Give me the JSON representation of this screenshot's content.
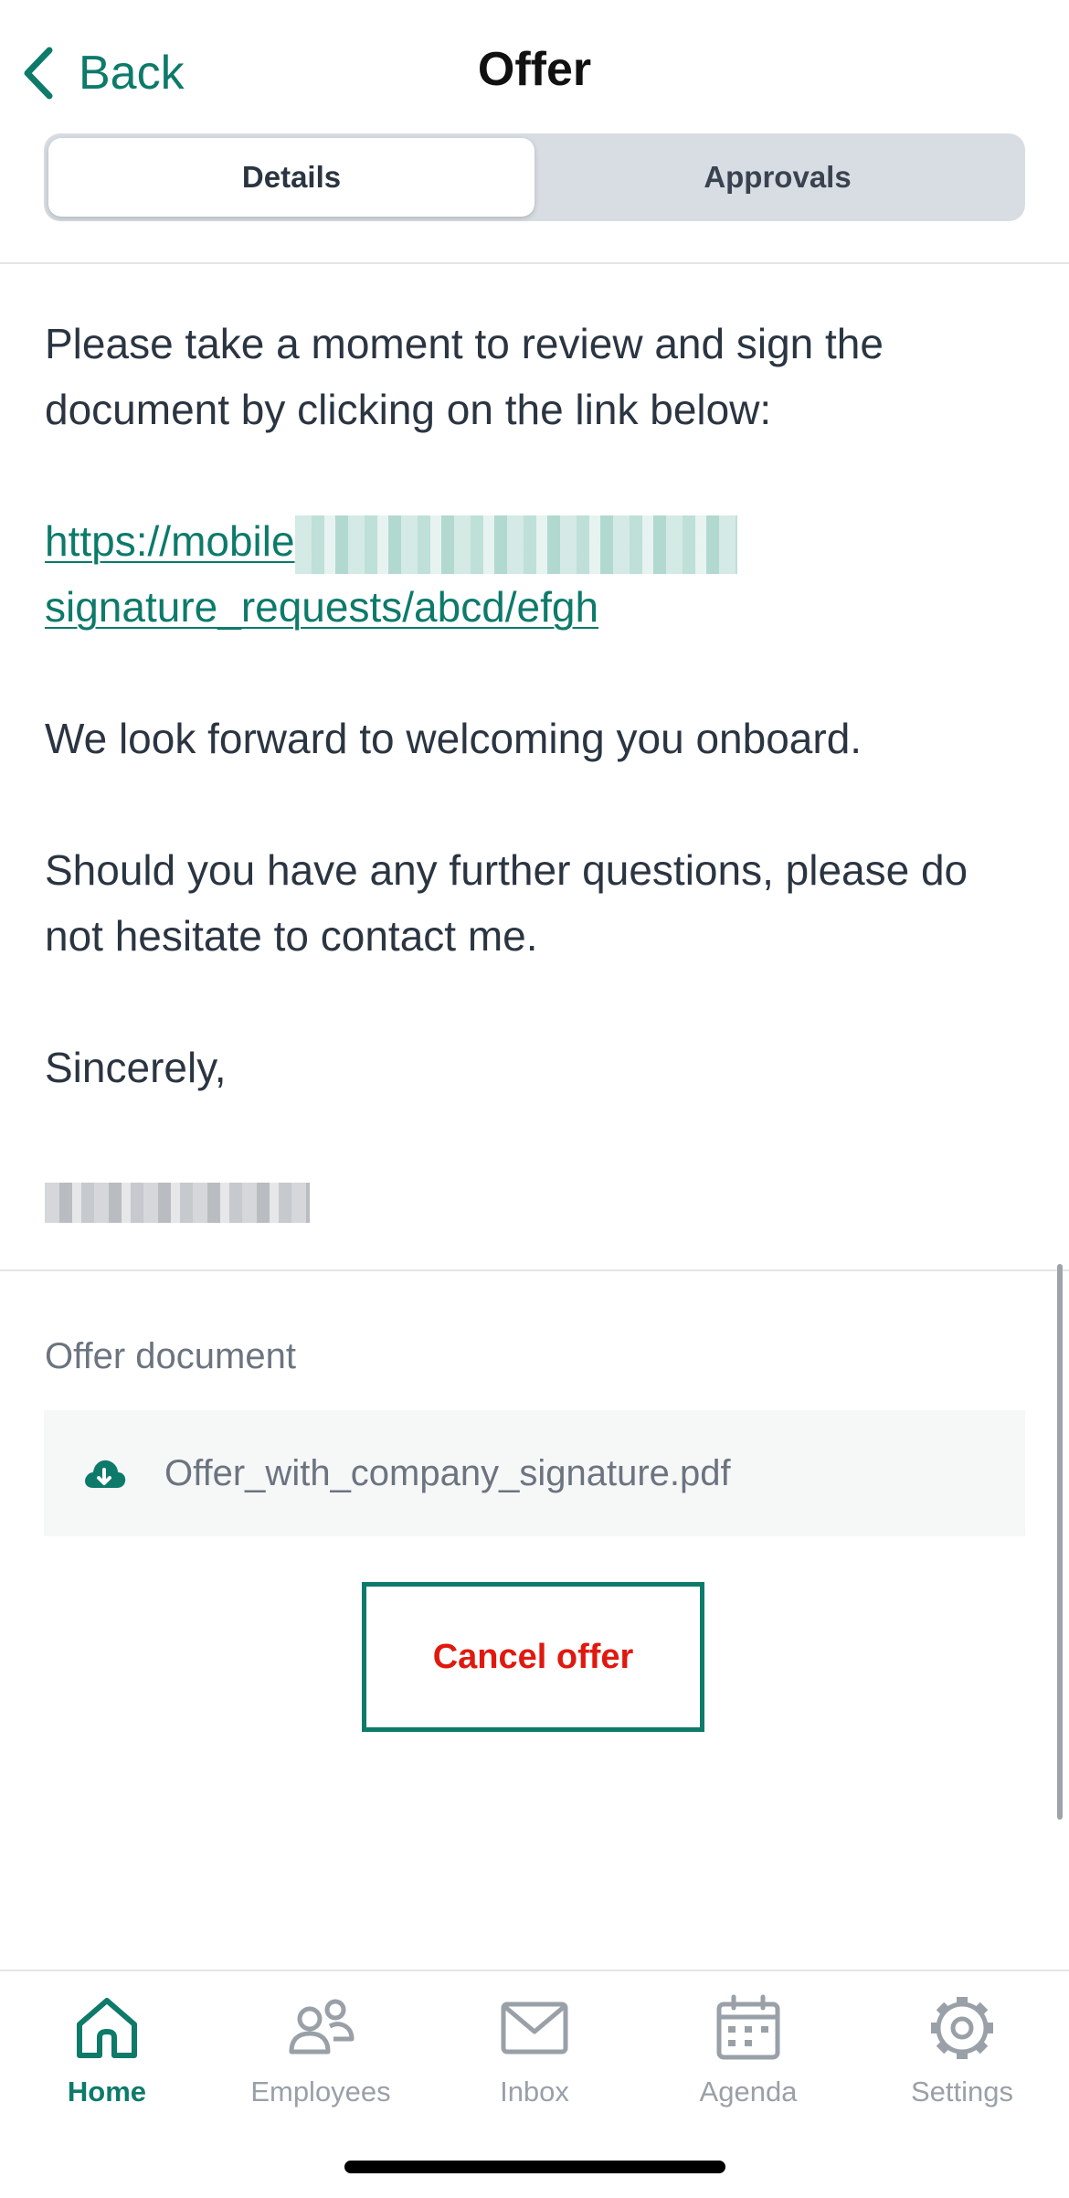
{
  "header": {
    "back_label": "Back",
    "title": "Offer"
  },
  "segments": [
    {
      "label": "Details",
      "active": true
    },
    {
      "label": "Approvals",
      "active": false
    }
  ],
  "message": {
    "intro": "Please take a moment to review and sign the document by clicking on the link below:",
    "link_prefix": "https://mobile",
    "link_suffix": "signature_requests/abcd/efgh",
    "welcome": "We look forward to welcoming you onboard.",
    "questions": "Should you have any further questions, please do not hesitate to contact me.",
    "closing": "Sincerely,"
  },
  "offer_document": {
    "label": "Offer document",
    "filename": "Offer_with_company_signature.pdf",
    "icon": "download-cloud-icon"
  },
  "actions": {
    "cancel_label": "Cancel offer"
  },
  "tabbar": {
    "items": [
      {
        "label": "Home",
        "icon": "home-icon",
        "active": true
      },
      {
        "label": "Employees",
        "icon": "users-icon",
        "active": false
      },
      {
        "label": "Inbox",
        "icon": "mail-icon",
        "active": false
      },
      {
        "label": "Agenda",
        "icon": "calendar-icon",
        "active": false
      },
      {
        "label": "Settings",
        "icon": "gear-icon",
        "active": false
      }
    ]
  },
  "colors": {
    "accent": "#0d7a6a",
    "danger": "#e0190f",
    "text": "#2b3542",
    "muted": "#9aa0a8"
  }
}
